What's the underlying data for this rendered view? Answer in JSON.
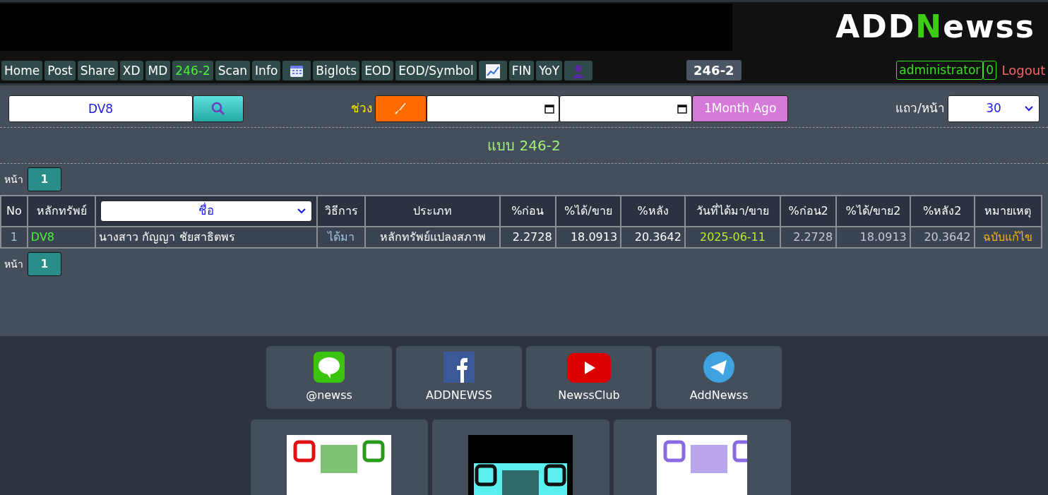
{
  "logo": {
    "parts": [
      "ADD",
      "N",
      "ewss"
    ]
  },
  "nav": [
    {
      "kind": "text",
      "label": "Home",
      "selected": false
    },
    {
      "kind": "text",
      "label": "Post",
      "selected": false
    },
    {
      "kind": "text",
      "label": "Share",
      "selected": false
    },
    {
      "kind": "text",
      "label": "XD",
      "selected": false
    },
    {
      "kind": "text",
      "label": "MD",
      "selected": false
    },
    {
      "kind": "text",
      "label": "246-2",
      "selected": true
    },
    {
      "kind": "text",
      "label": "Scan",
      "selected": false
    },
    {
      "kind": "text",
      "label": "Info",
      "selected": false
    },
    {
      "kind": "calendar",
      "selected": false
    },
    {
      "kind": "text",
      "label": "Biglots",
      "selected": false
    },
    {
      "kind": "text",
      "label": "EOD",
      "selected": false
    },
    {
      "kind": "text",
      "label": "EOD/Symbol",
      "selected": false
    },
    {
      "kind": "chart",
      "selected": false
    },
    {
      "kind": "text",
      "label": "FIN",
      "selected": false
    },
    {
      "kind": "text",
      "label": "YoY",
      "selected": false
    },
    {
      "kind": "user",
      "selected": false
    }
  ],
  "page_badge": "246-2",
  "user": {
    "name": "administrator",
    "count": "0",
    "logout": "Logout"
  },
  "filter": {
    "symbol": "DV8",
    "range_label": "ช่วง",
    "month_button": "1Month Ago",
    "rows_label": "แถว/หน้า",
    "rows_value": "30"
  },
  "title": "แบบ 246-2",
  "pager": {
    "label": "หน้า",
    "pages": [
      {
        "label": "1",
        "selected": true
      }
    ]
  },
  "table": {
    "columns": [
      {
        "kind": "text",
        "label": "No"
      },
      {
        "kind": "text",
        "label": "หลักทรัพย์"
      },
      {
        "kind": "select",
        "label": "ชื่อ"
      },
      {
        "kind": "text",
        "label": "วิธีการ"
      },
      {
        "kind": "text",
        "label": "ประเภท"
      },
      {
        "kind": "text",
        "label": "%ก่อน"
      },
      {
        "kind": "text",
        "label": "%ได้/ขาย"
      },
      {
        "kind": "text",
        "label": "%หลัง"
      },
      {
        "kind": "text",
        "label": "วันที่ได้มา/ขาย"
      },
      {
        "kind": "text",
        "label": "%ก่อน2"
      },
      {
        "kind": "text",
        "label": "%ได้/ขาย2"
      },
      {
        "kind": "text",
        "label": "%หลัง2"
      },
      {
        "kind": "text",
        "label": "หมายเหตุ"
      }
    ],
    "rows": [
      [
        "1",
        "DV8",
        "นางสาว กัญญา ชัยสาธิตพร",
        "ได้มา",
        "หลักทรัพย์แปลงสภาพ",
        "2.2728",
        "18.0913",
        "20.3642",
        "2025-06-11",
        "2.2728",
        "18.0913",
        "20.3642",
        "ฉบับแก้ไข"
      ]
    ]
  },
  "pager_bottom": {
    "label": "หน้า",
    "pages": [
      {
        "label": "1",
        "selected": true
      }
    ]
  },
  "social": [
    {
      "kind": "line",
      "label": "@newss"
    },
    {
      "kind": "facebook",
      "label": "ADDNEWSS"
    },
    {
      "kind": "youtube",
      "label": "NewssClub"
    },
    {
      "kind": "telegram",
      "label": "AddNewss"
    }
  ]
}
